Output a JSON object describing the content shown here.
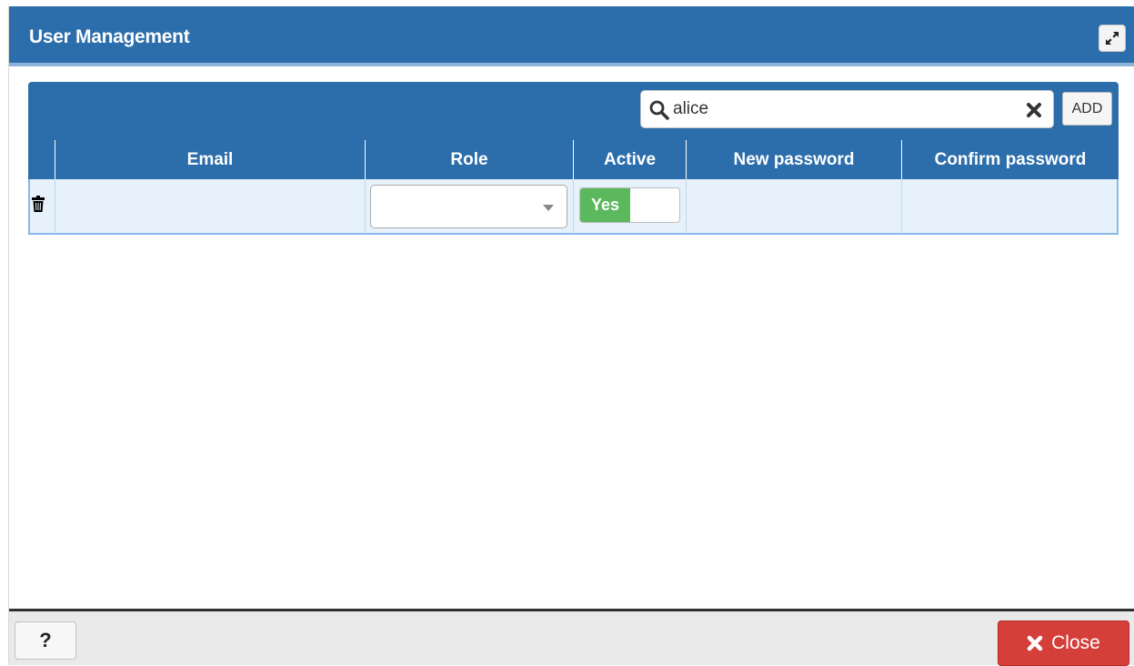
{
  "dialog": {
    "title": "User Management",
    "maximize_icon": "expand-icon"
  },
  "toolbar": {
    "search_icon": "search-icon",
    "search_value": "alice",
    "clear_icon": "clear-icon",
    "add_label": "ADD"
  },
  "table": {
    "columns": [
      "Email",
      "Role",
      "Active",
      "New password",
      "Confirm password"
    ],
    "rows": [
      {
        "delete_icon": "trash-icon",
        "email": "",
        "role": "",
        "active_label": "Yes",
        "active": true,
        "new_password": "",
        "confirm_password": ""
      }
    ]
  },
  "footer": {
    "help_label": "?",
    "close_label": "Close",
    "close_icon": "close-x-icon"
  },
  "colors": {
    "header_blue": "#2c6dab",
    "row_highlight": "#e6f1fb",
    "toggle_on": "#5cb85c",
    "close_red": "#d43f3a"
  }
}
